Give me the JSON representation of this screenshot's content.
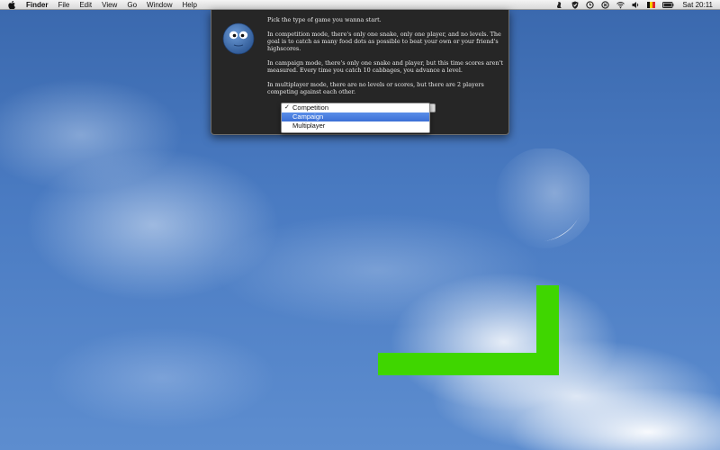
{
  "menubar": {
    "apple_icon": "apple-icon",
    "items": [
      {
        "label": "Finder"
      },
      {
        "label": "File"
      },
      {
        "label": "Edit"
      },
      {
        "label": "View"
      },
      {
        "label": "Go"
      },
      {
        "label": "Window"
      },
      {
        "label": "Help"
      }
    ],
    "status_icons": [
      "script-icon",
      "shield-icon",
      "sync-icon",
      "time-machine-icon",
      "wifi-icon",
      "volume-icon",
      "flag-icon",
      "battery-icon"
    ],
    "clock": "Sat 20:11"
  },
  "dialog": {
    "icon": "snake-face-icon",
    "paragraphs": [
      "Pick the type of game you wanna start.",
      "In competition mode, there's only one snake, only one player, and no levels. The goal is to catch as many food dots as possible to beat your own or your friend's highscores.",
      "In campaign mode, there's only one snake and player, but this time scores aren't measured. Every time you catch 10 cabbages, you advance a level.",
      "In multiplayer mode, there are no levels or scores, but there are 2 players competing against each other."
    ],
    "game_mode_menu": {
      "options": [
        {
          "label": "Competition",
          "checked": "✓"
        },
        {
          "label": "Campaign"
        },
        {
          "label": "Multiplayer"
        }
      ],
      "highlighted": "Campaign",
      "checked": "Competition"
    }
  },
  "desktop": {
    "snake_color": "#3fd600",
    "moon_icon": "crescent-moon"
  }
}
